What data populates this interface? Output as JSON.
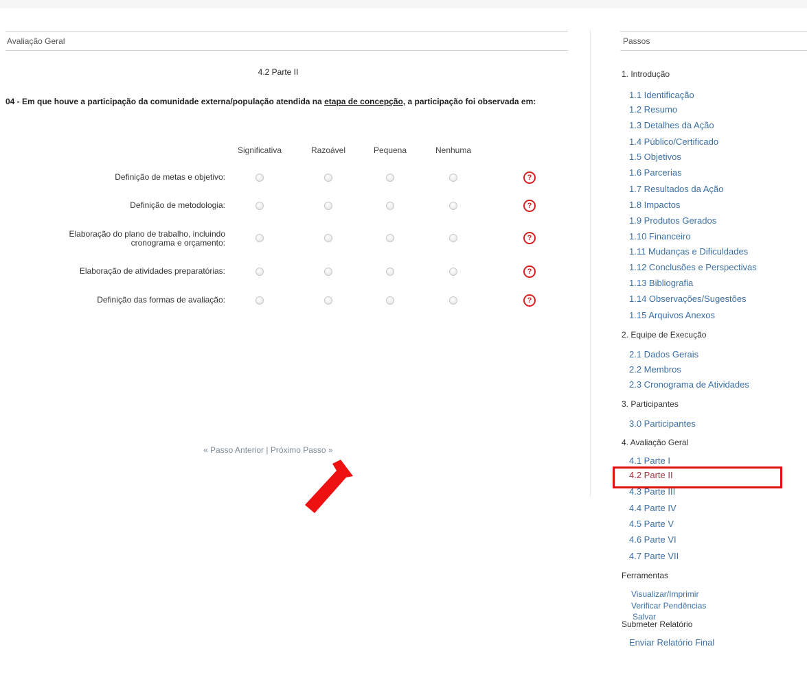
{
  "main": {
    "section_title": "Avaliação Geral",
    "step_title": "4.2 Parte II",
    "question_prefix": "04 - Em que houve a participação da comunidade externa/população atendida na ",
    "question_underlined": "etapa de concepção",
    "question_suffix": ", a participação foi observada em:",
    "columns": [
      "Significativa",
      "Razoável",
      "Pequena",
      "Nenhuma"
    ],
    "rows": [
      {
        "label_line1": "Definição de metas e objetivo:",
        "label_line2": ""
      },
      {
        "label_line1": "Definição de metodologia:",
        "label_line2": ""
      },
      {
        "label_line1": "Elaboração do plano de trabalho, incluindo",
        "label_line2": "cronograma e orçamento:"
      },
      {
        "label_line1": "Elaboração de atividades preparatórias:",
        "label_line2": ""
      },
      {
        "label_line1": "Definição das formas de avaliação:",
        "label_line2": ""
      }
    ],
    "help_glyph": "?",
    "nav": {
      "prev": "« Passo Anterior",
      "separator": " | ",
      "next": "Próximo Passo »"
    }
  },
  "sidebar": {
    "title": "Passos",
    "sections": [
      {
        "label": "1. Introdução"
      },
      {
        "label": "2. Equipe de Execução"
      },
      {
        "label": "3. Participantes"
      },
      {
        "label": "4. Avaliação Geral"
      },
      {
        "label": "Ferramentas"
      },
      {
        "label": "Submeter Relatório"
      }
    ],
    "items": [
      "1.1 Identificação",
      "1.2 Resumo",
      "1.3 Detalhes da Ação",
      "1.4 Público/Certificado",
      "1.5 Objetivos",
      "1.6 Parcerias",
      "1.7 Resultados da Ação",
      "1.8 Impactos",
      "1.9 Produtos Gerados",
      "1.10 Financeiro",
      "1.11 Mudanças e Dificuldades",
      "1.12 Conclusões e Perspectivas",
      "1.13 Bibliografia",
      "1.14 Observações/Sugestões",
      "1.15 Arquivos Anexos",
      "2.1 Dados Gerais",
      "2.2 Membros",
      "2.3 Cronograma de Atividades",
      "3.0 Participantes",
      "4.1 Parte I",
      "4.2 Parte II",
      "4.3 Parte III",
      "4.4 Parte IV",
      "4.5 Parte V",
      "4.6 Parte VI",
      "4.7 Parte VII"
    ],
    "current_item": "4.2 Parte II",
    "tools": [
      "Visualizar/Imprimir",
      "Verificar Pendências",
      "Salvar"
    ],
    "submit": "Enviar Relatório Final"
  },
  "colors": {
    "link": "#3b6fa5",
    "current": "#a0343e",
    "highlight": "#e01010",
    "help": "#d62020"
  }
}
